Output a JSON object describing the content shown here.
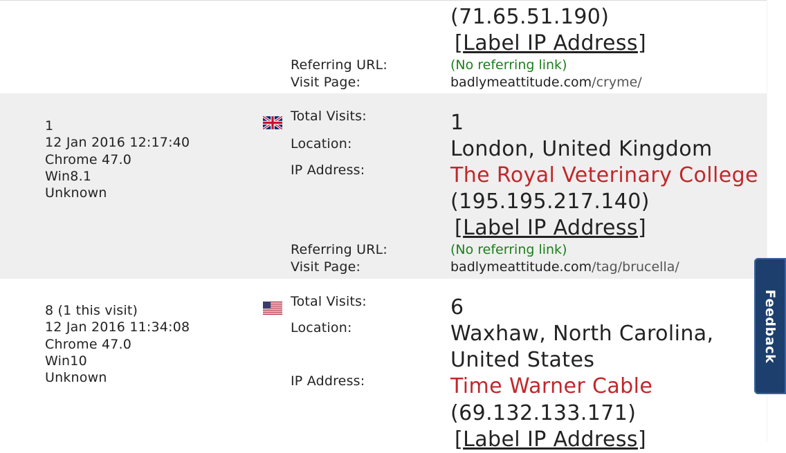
{
  "labels": {
    "total_visits": "Total Visits:",
    "location": "Location:",
    "ip_address": "IP Address:",
    "referring_url": "Referring URL:",
    "visit_page": "Visit Page:",
    "label_ip": "Label IP Address",
    "no_referrer": "(No referring link)"
  },
  "entries": [
    {
      "ip": "(71.65.51.190)",
      "visit_host": "badlymeattitude.com",
      "visit_path": "/cryme/"
    },
    {
      "visit_count": "1",
      "datetime": "12 Jan 2016 12:17:40",
      "browser": "Chrome 47.0",
      "os": "Win8.1",
      "resolution": "Unknown",
      "flag": "uk-flag-icon",
      "total_visits": "1",
      "location": "London, United Kingdom",
      "isp": "The Royal Veterinary College",
      "ip": "(195.195.217.140)",
      "visit_host": "badlymeattitude.com",
      "visit_path": "/tag/brucella/"
    },
    {
      "visit_count": "8 (1 this visit)",
      "datetime": "12 Jan 2016 11:34:08",
      "browser": "Chrome 47.0",
      "os": "Win10",
      "resolution": "Unknown",
      "flag": "us-flag-icon",
      "total_visits": "6",
      "location_line1": "Waxhaw, North Carolina,",
      "location_line2": "United States",
      "isp": "Time Warner Cable",
      "ip": "(69.132.133.171)"
    }
  ],
  "feedback_tab": "Feedback",
  "colors": {
    "isp_red": "#c0282b",
    "referrer_green": "#1b7f1b",
    "feedback_bg": "#1d3f6e",
    "row_shade": "#efefef"
  }
}
